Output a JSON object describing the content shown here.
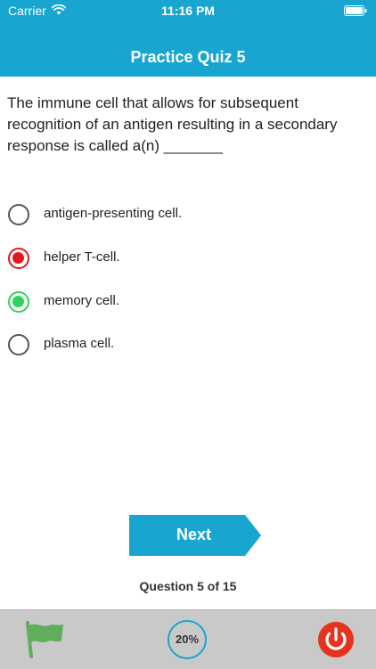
{
  "status_bar": {
    "carrier": "Carrier",
    "time": "11:16 PM"
  },
  "header": {
    "title": "Practice Quiz 5",
    "background_color": "#18a5cf"
  },
  "question": {
    "text": "The immune cell that allows for subsequent recognition of an antigen resulting in a secondary response is called a(n) _______"
  },
  "options": [
    {
      "label": "antigen-presenting cell.",
      "state": "unselected"
    },
    {
      "label": "helper T-cell.",
      "state": "incorrect",
      "color": "#e3171b"
    },
    {
      "label": "memory cell.",
      "state": "correct",
      "color": "#2fd45a"
    },
    {
      "label": "plasma cell.",
      "state": "unselected"
    }
  ],
  "next_button": {
    "label": "Next",
    "color": "#18a5cf"
  },
  "question_counter": "Question 5 of 15",
  "bottom_bar": {
    "flag_icon": "flag-icon",
    "progress_label": "20%",
    "progress_value": 0.2,
    "power_icon": "power-icon"
  }
}
